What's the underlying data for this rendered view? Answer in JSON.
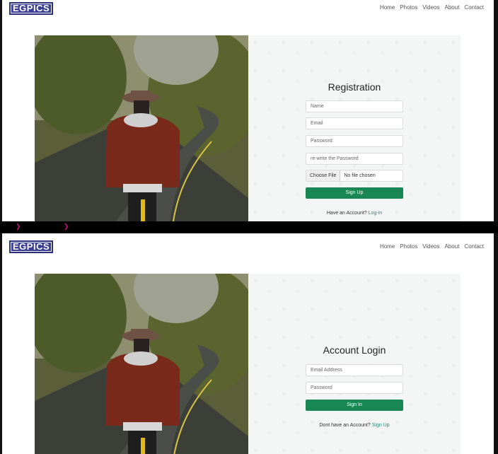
{
  "site": {
    "logo": "EGPICS",
    "nav": [
      "Home",
      "Photos",
      "Videos",
      "About",
      "Contact"
    ]
  },
  "registration": {
    "title": "Registration",
    "name_placeholder": "Name",
    "email_placeholder": "Email",
    "password_placeholder": "Password",
    "repassword_placeholder": "re-write the Password",
    "file_button": "Choose File",
    "file_status": "No file chosen",
    "submit_label": "Sign Up",
    "footer_text": "Have an Account?",
    "footer_link": "Log-in"
  },
  "login": {
    "title": "Account Login",
    "email_placeholder": "Email Address",
    "password_placeholder": "Password",
    "submit_label": "Sign In",
    "footer_text": "Dont have an Account?",
    "footer_link": "Sign Up"
  },
  "colors": {
    "primary_button": "#198754",
    "logo_bg": "#3b3f94",
    "link": "#1a8a7a"
  }
}
